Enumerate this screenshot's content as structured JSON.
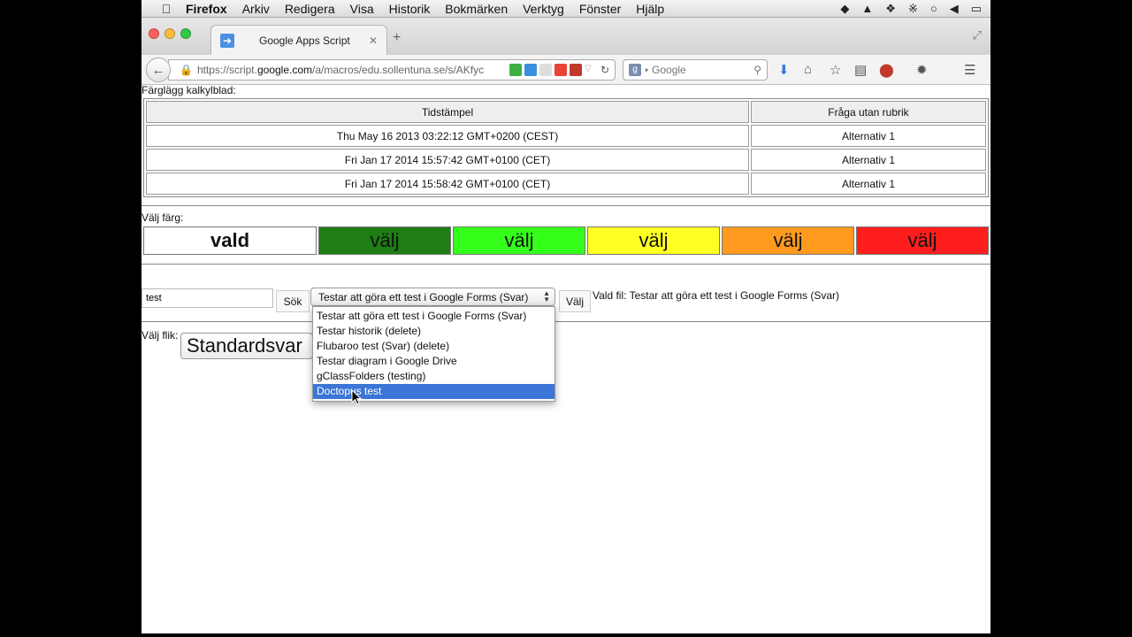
{
  "menubar": {
    "app": "Firefox",
    "items": [
      "Arkiv",
      "Redigera",
      "Visa",
      "Historik",
      "Bokmärken",
      "Verktyg",
      "Fönster",
      "Hjälp"
    ],
    "status_icons": [
      "evernote-icon",
      "drive-icon",
      "dropbox-icon",
      "bluetooth-icon",
      "wifi-icon",
      "volume-icon",
      "battery-icon"
    ]
  },
  "tab": {
    "title": "Google Apps Script"
  },
  "navbar": {
    "url": "https://script.google.com/a/macros/edu.sollentuna.se/s/AKfyc",
    "url_display_prefix": "https://script.",
    "url_display_domain": "google.com",
    "url_display_rest": "/a/macros/edu.sollentuna.se/s/AKfyc",
    "search_placeholder": "Google"
  },
  "page": {
    "sheet_caption": "Färglägg kalkylblad:",
    "table": {
      "headers": [
        "Tidstämpel",
        "Fråga utan rubrik"
      ],
      "rows": [
        [
          "Thu May 16 2013 03:22:12 GMT+0200 (CEST)",
          "Alternativ 1"
        ],
        [
          "Fri Jan 17 2014 15:57:42 GMT+0100 (CET)",
          "Alternativ 1"
        ],
        [
          "Fri Jan 17 2014 15:58:42 GMT+0100 (CET)",
          "Alternativ 1"
        ]
      ]
    },
    "color_caption": "Välj färg:",
    "selected_label": "vald",
    "choices": [
      {
        "label": "välj",
        "color": "#1e7d14"
      },
      {
        "label": "välj",
        "color": "#33ff1a"
      },
      {
        "label": "välj",
        "color": "#ffff22"
      },
      {
        "label": "välj",
        "color": "#ff9a1e"
      },
      {
        "label": "välj",
        "color": "#ff1e1e"
      }
    ],
    "search_value": "test",
    "search_button": "Sök",
    "file_select_value": "Testar att göra ett test i Google Forms (Svar)",
    "valj_button": "Välj",
    "selected_file_text": "Vald fil: Testar att göra ett test i Google Forms (Svar)",
    "tab_caption": "Välj flik:",
    "tab_select_value": "Standardsvar",
    "dropdown_options": [
      "Testar att göra ett test i Google Forms (Svar)",
      "Testar historik (delete)",
      "Flubaroo test (Svar) (delete)",
      "Testar diagram i Google Drive",
      "gClassFolders (testing)",
      "Doctopus test"
    ],
    "highlighted_option": "Doctopus test"
  }
}
